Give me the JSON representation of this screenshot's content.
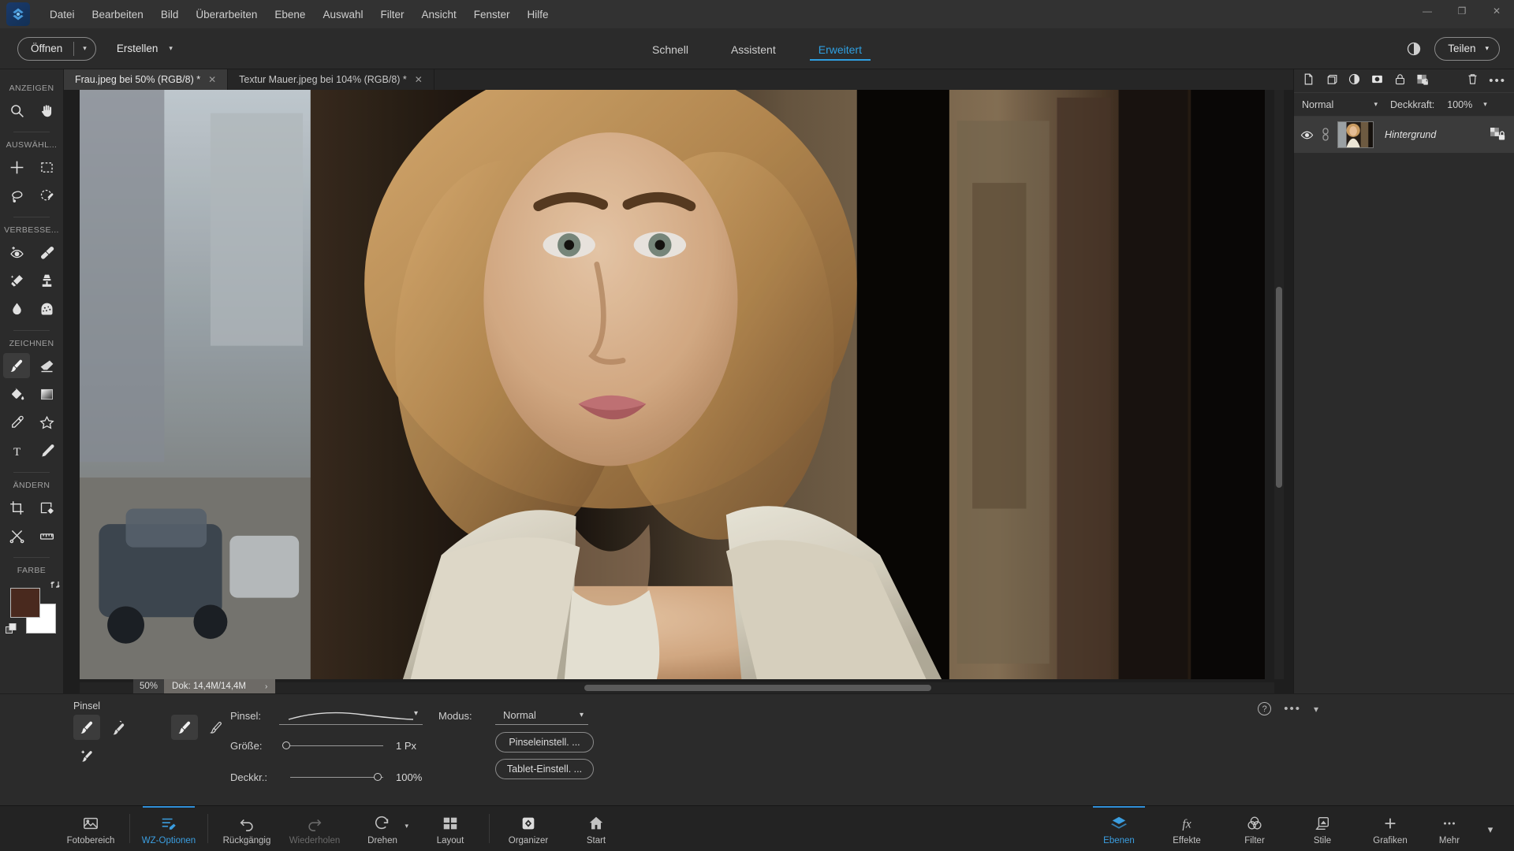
{
  "app": {
    "logo_icon": "photoshop-elements-logo",
    "window_controls": {
      "minimize": "—",
      "maximize": "❐",
      "close": "✕"
    }
  },
  "menubar": {
    "items": [
      {
        "label": "Datei"
      },
      {
        "label": "Bearbeiten"
      },
      {
        "label": "Bild"
      },
      {
        "label": "Überarbeiten"
      },
      {
        "label": "Ebene"
      },
      {
        "label": "Auswahl"
      },
      {
        "label": "Filter"
      },
      {
        "label": "Ansicht"
      },
      {
        "label": "Fenster"
      },
      {
        "label": "Hilfe"
      }
    ]
  },
  "topbar": {
    "open_label": "Öffnen",
    "open_caret": "▾",
    "create_label": "Erstellen",
    "create_caret": "▾",
    "modes": [
      {
        "label": "Schnell",
        "active": false
      },
      {
        "label": "Assistent",
        "active": false
      },
      {
        "label": "Erweitert",
        "active": true
      }
    ],
    "contrast_icon": "contrast-icon",
    "share_label": "Teilen",
    "share_caret": "▾",
    "accent_color": "#2f9fe0"
  },
  "tools": {
    "groups": [
      {
        "label": "ANZEIGEN",
        "rows": [
          [
            {
              "name": "zoom-tool",
              "icon": "magnifier"
            },
            {
              "name": "hand-tool",
              "icon": "hand"
            }
          ]
        ]
      },
      {
        "label": "AUSWÄHL...",
        "rows": [
          [
            {
              "name": "move-tool",
              "icon": "move-cross"
            },
            {
              "name": "marquee-tool",
              "icon": "rect-marquee"
            }
          ],
          [
            {
              "name": "lasso-tool",
              "icon": "lasso"
            },
            {
              "name": "quick-selection-tool",
              "icon": "quick-select-brush"
            }
          ]
        ]
      },
      {
        "label": "VERBESSE...",
        "rows": [
          [
            {
              "name": "red-eye-tool",
              "icon": "eye-plus"
            },
            {
              "name": "spot-healing-tool",
              "icon": "healing-bandage"
            }
          ],
          [
            {
              "name": "smart-brush-tool",
              "icon": "smart-brush"
            },
            {
              "name": "clone-stamp-tool",
              "icon": "stamp"
            }
          ],
          [
            {
              "name": "blur-tool",
              "icon": "water-drop"
            },
            {
              "name": "sponge-tool",
              "icon": "sponge"
            }
          ]
        ]
      },
      {
        "label": "ZEICHNEN",
        "rows": [
          [
            {
              "name": "brush-tool",
              "icon": "paintbrush",
              "active": true
            },
            {
              "name": "eraser-tool",
              "icon": "eraser"
            }
          ],
          [
            {
              "name": "paint-bucket-tool",
              "icon": "paint-bucket"
            },
            {
              "name": "gradient-tool",
              "icon": "gradient-square"
            }
          ],
          [
            {
              "name": "color-picker-tool",
              "icon": "eyedropper"
            },
            {
              "name": "custom-shape-tool",
              "icon": "star-shape"
            }
          ],
          [
            {
              "name": "type-tool",
              "icon": "type-T"
            },
            {
              "name": "pencil-tool",
              "icon": "pencil"
            }
          ]
        ]
      },
      {
        "label": "ÄNDERN",
        "rows": [
          [
            {
              "name": "crop-tool",
              "icon": "crop"
            },
            {
              "name": "recompose-tool",
              "icon": "recompose-gear"
            }
          ],
          [
            {
              "name": "content-aware-move-tool",
              "icon": "scissors-move"
            },
            {
              "name": "straighten-tool",
              "icon": "straighten"
            }
          ]
        ]
      }
    ],
    "color_section": {
      "label": "FARBE",
      "foreground": "#49291e",
      "background": "#ffffff",
      "swap_icon": "swap-colors-icon",
      "reset_icon": "reset-colors-icon"
    }
  },
  "documents": {
    "tabs": [
      {
        "title": "Frau.jpeg bei 50% (RGB/8) *",
        "close": "✕",
        "active": true
      },
      {
        "title": "Textur Mauer.jpeg bei 104% (RGB/8) *",
        "close": "✕",
        "active": false
      }
    ]
  },
  "status": {
    "zoom": "50%",
    "doc_size": "Dok: 14,4M/14,4M",
    "arrow": "›"
  },
  "layers_panel": {
    "toolbar_icons": [
      {
        "name": "new-layer-icon"
      },
      {
        "name": "duplicate-layer-icon"
      },
      {
        "name": "adjustment-layer-icon"
      },
      {
        "name": "layer-mask-icon"
      },
      {
        "name": "lock-layer-icon"
      },
      {
        "name": "lock-transparency-icon"
      },
      {
        "name": "delete-layer-icon"
      },
      {
        "name": "more-options-icon"
      }
    ],
    "blend_mode": "Normal",
    "blend_caret": "▾",
    "opacity_label": "Deckkraft:",
    "opacity_value": "100%",
    "opacity_caret": "▾",
    "layers": [
      {
        "name": "Hintergrund",
        "visible": true,
        "locked": true,
        "selected": true,
        "eye_icon": "eye-icon",
        "lock_icon": "lock-transparency-icon"
      }
    ]
  },
  "options_panel": {
    "title": "Pinsel",
    "tool_buttons": [
      {
        "name": "brush-tool-option",
        "icon": "paintbrush",
        "active": true
      },
      {
        "name": "impressionist-brush-option",
        "icon": "impressionist-brush",
        "active": false
      },
      {
        "name": "brush-variant-option",
        "icon": "paintbrush",
        "active": true
      },
      {
        "name": "color-replacement-brush-option",
        "icon": "color-replace-brush",
        "active": false
      },
      {
        "name": "brush-settings-option",
        "icon": "brush-swap",
        "active": false
      }
    ],
    "brush_label": "Pinsel:",
    "brush_caret": "▾",
    "size_label": "Größe:",
    "size_value": "1 Px",
    "size_percent": 0,
    "opacity_label": "Deckkr.:",
    "opacity_value": "100%",
    "opacity_percent": 100,
    "mode_label": "Modus:",
    "mode_value": "Normal",
    "mode_caret": "▾",
    "brush_settings_button": "Pinseleinstell. ...",
    "tablet_settings_button": "Tablet-Einstell. ...",
    "help_icon": "?",
    "more_icon": "•••",
    "collapse_icon": "▾"
  },
  "taskbar": {
    "left_items": [
      {
        "label": "Fotobereich",
        "icon": "photo-bin-icon",
        "active": false,
        "disabled": false
      },
      {
        "label": "WZ-Optionen",
        "icon": "tool-options-icon",
        "active": true,
        "disabled": false
      },
      {
        "label": "Rückgängig",
        "icon": "undo-icon",
        "active": false,
        "disabled": false
      },
      {
        "label": "Wiederholen",
        "icon": "redo-icon",
        "active": false,
        "disabled": true
      },
      {
        "label": "Drehen",
        "icon": "rotate-icon",
        "active": false,
        "disabled": false,
        "caret": "▾"
      },
      {
        "label": "Layout",
        "icon": "layout-icon",
        "active": false,
        "disabled": false
      },
      {
        "label": "Organizer",
        "icon": "organizer-icon",
        "active": false,
        "disabled": false
      },
      {
        "label": "Start",
        "icon": "home-icon",
        "active": false,
        "disabled": false
      }
    ],
    "right_items": [
      {
        "label": "Ebenen",
        "icon": "layers-icon",
        "active": true
      },
      {
        "label": "Effekte",
        "icon": "fx-icon",
        "active": false
      },
      {
        "label": "Filter",
        "icon": "filter-rings-icon",
        "active": false
      },
      {
        "label": "Stile",
        "icon": "styles-icon",
        "active": false
      },
      {
        "label": "Grafiken",
        "icon": "plus-icon",
        "active": false
      },
      {
        "label": "Mehr",
        "icon": "more-dots-icon",
        "active": false,
        "caret": "▾"
      }
    ]
  }
}
